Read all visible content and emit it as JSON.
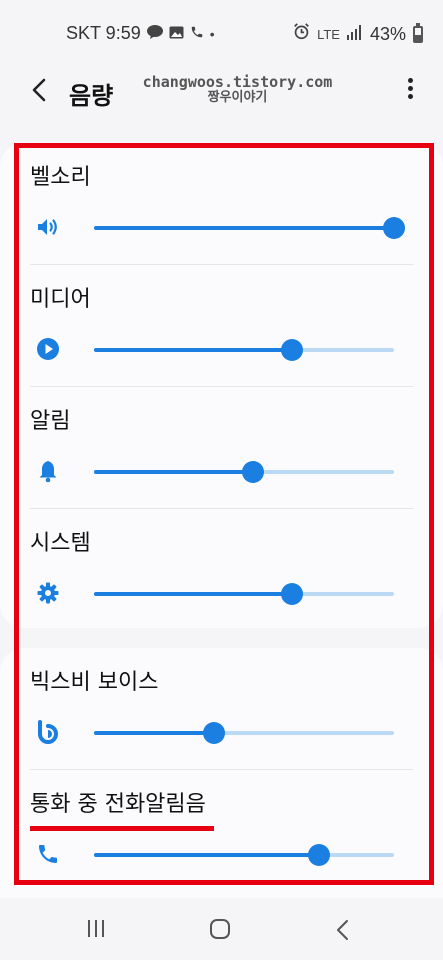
{
  "status_bar": {
    "carrier_time": "SKT 9:59",
    "notification_icons": [
      "talk-icon",
      "gallery-icon",
      "phone-icon",
      "dot-icon"
    ],
    "lte": "LTE",
    "battery": "43%"
  },
  "app_bar": {
    "title": "음량",
    "watermark_line1": "changwoos.tistory.com",
    "watermark_line2": "짱우이야기"
  },
  "sections": [
    {
      "items": [
        {
          "label": "벨소리",
          "icon": "speaker-icon",
          "level": 1.0
        },
        {
          "label": "미디어",
          "icon": "play-icon",
          "level": 0.66
        },
        {
          "label": "알림",
          "icon": "bell-icon",
          "level": 0.53
        },
        {
          "label": "시스템",
          "icon": "gear-icon",
          "level": 0.66
        }
      ]
    },
    {
      "items": [
        {
          "label": "빅스비 보이스",
          "icon": "bixby-icon",
          "level": 0.4
        },
        {
          "label": "통화 중 전화알림음",
          "icon": "phone-icon",
          "level": 0.75
        }
      ]
    }
  ],
  "colors": {
    "accent": "#1a7fe0",
    "track": "#b9d9f5",
    "highlight": "#e60012",
    "background": "#f5f5f7",
    "card": "#fbfbfd"
  }
}
